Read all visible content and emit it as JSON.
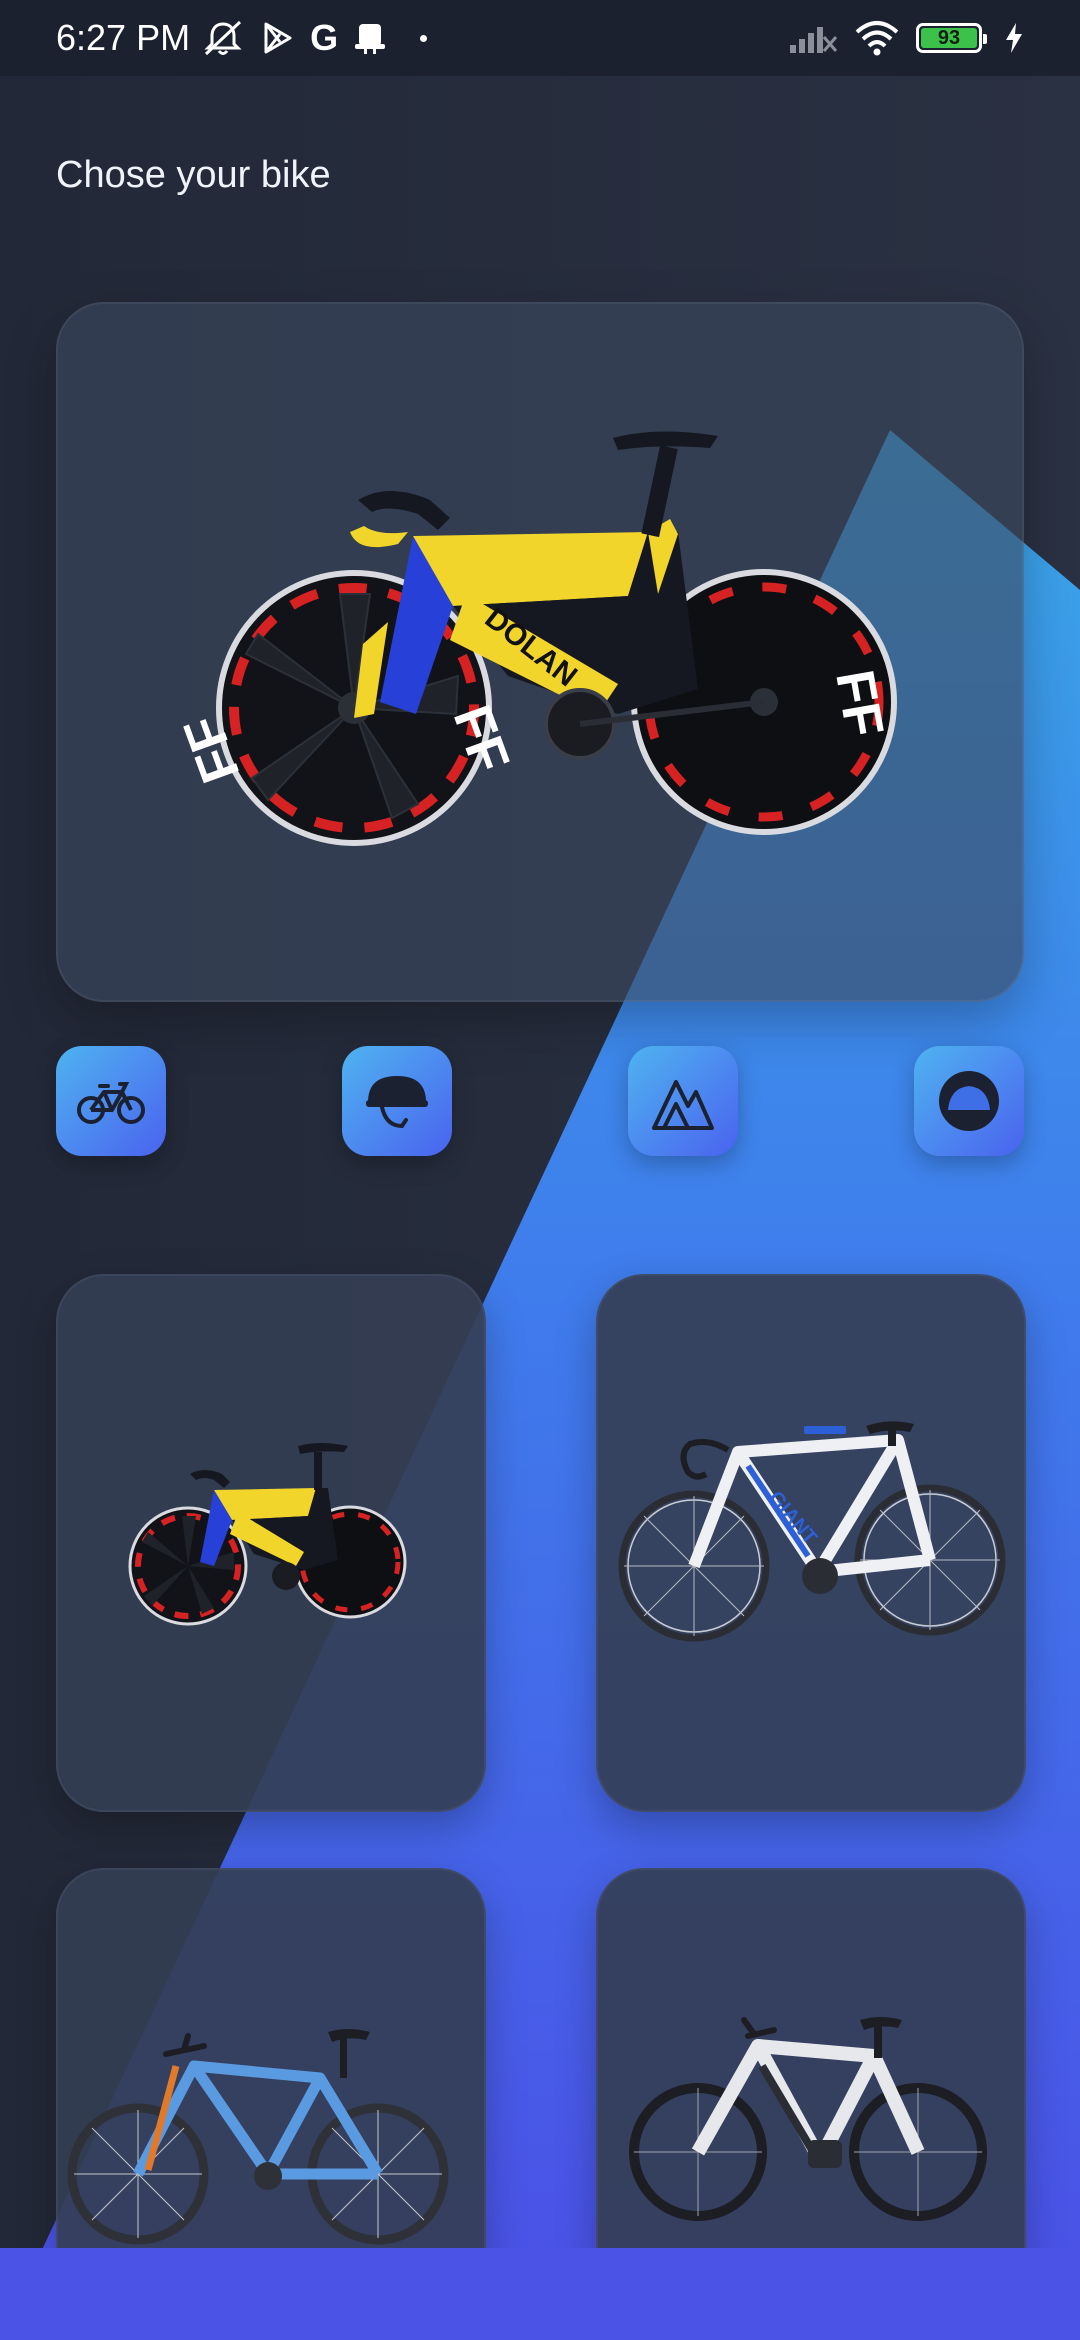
{
  "status_bar": {
    "time": "6:27 PM",
    "left_icons": [
      "mute-bell-icon",
      "play-store-icon",
      "google-icon",
      "notification-icon"
    ],
    "g_letter": "G",
    "battery_percent": "93",
    "right_icons": [
      "signal-icon",
      "wifi-icon",
      "battery-icon",
      "charging-icon"
    ]
  },
  "page": {
    "title": "Chose your bike"
  },
  "hero": {
    "product": "track-bike-dolan-image",
    "frame_text": "DOLAN"
  },
  "categories": [
    {
      "name": "bicycle-icon"
    },
    {
      "name": "helmet-icon"
    },
    {
      "name": "mountain-icon"
    },
    {
      "name": "wheel-icon"
    }
  ],
  "products": [
    {
      "name": "track-bike-dolan"
    },
    {
      "name": "road-bike-giant",
      "frame_text": "GIANT"
    },
    {
      "name": "mountain-bike-blue"
    },
    {
      "name": "ebike-white"
    }
  ],
  "colors": {
    "background": "#252b3a",
    "accent_start": "#4fb3f0",
    "accent_end": "#4a62ef",
    "bottom_bar": "#4a53e6"
  }
}
